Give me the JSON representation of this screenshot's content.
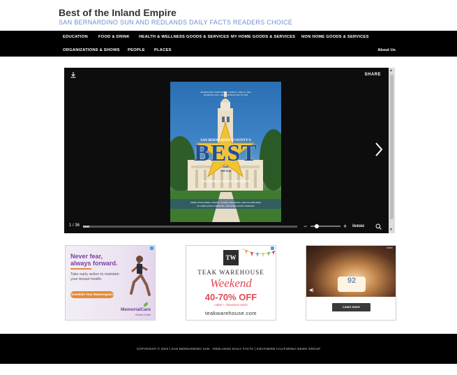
{
  "header": {
    "title": "Best of the Inland Empire",
    "tagline": "SAN BERNARDINO SUN AND REDLANDS DAILY FACTS READERS CHOICE"
  },
  "nav": {
    "items": [
      "EDUCATION",
      "FOOD & DRINK",
      "HEALTH & WELLNESS GOODS & SERVICES",
      "MY HOME GOODS & SERVICES",
      "NON HOME GOODS & SERVICES",
      "ORGANIZATIONS & SHOWS",
      "PEOPLE",
      "PLACES"
    ],
    "about": "About Us"
  },
  "viewer": {
    "share_label": "SHARE",
    "page_count": "1 / 36",
    "progress_fraction": 0.03,
    "zoom_fraction": 0.2,
    "brand": "issuu",
    "cover": {
      "topline_1": "ADVERTISING SUPPLEMENT  •  SUNDAY, JUNE 11, 2023",
      "topline_2": "SB.SBSUN.COM  •  REDLANDSDAILYFACTS.COM",
      "overtitle": "SAN BERNARDINO COUNTY'S",
      "title": "BEST",
      "sub_1": "2023",
      "sub_2": "THE SUN",
      "readers": "READERS CHOICE AWARDS",
      "footer_1": "INSIDE: FOOD & DRINK  •  PEOPLE  •  PLACES  •  EDUCATION  •  HEALTH & WELLNESS",
      "footer_2": "MY HOME GOODS & SERVICES  •  NON HOME GOODS & SERVICES"
    }
  },
  "ads": {
    "ad1": {
      "headline_1": "Never fear,",
      "headline_2": "always forward.",
      "body": "Take early action to maintain your breast health.",
      "button": "Schedule Your Mammogram",
      "brand": "MemorialCare",
      "subbrand": "Breast Center"
    },
    "ad2": {
      "logo": "TW",
      "brand": "TEAK WAREHOUSE",
      "script": "Weekend",
      "offer": "40-70% OFF",
      "small": "outlet + clearance stock",
      "url": "teakwarehouse.com"
    },
    "ad3": {
      "cake_number": "92",
      "button": "Learn more",
      "label": "Index"
    }
  },
  "footer": {
    "text": "COPYRIGHT © 2023 | SAN BERNARDINO SUN - REDLANDS DAILY FACTS | SOUTHERN CALIFORNIA NEWS GROUP"
  },
  "colors": {
    "tagline": "#6b8fc7",
    "nav_bg": "#000000",
    "ad_purple": "#7a3fa0",
    "ad_orange": "#e38a3a",
    "ad_red": "#e04a56"
  }
}
